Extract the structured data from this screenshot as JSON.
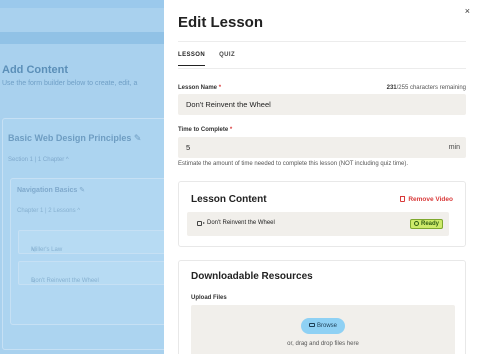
{
  "background": {
    "page_title": "Add Content",
    "page_subtitle": "Use the form builder below to create, edit, a",
    "course_title": "Basic Web Design Principles",
    "course_meta": "Section 1 | 1 Chapter ^",
    "chapter_title": "Navigation Basics",
    "chapter_meta": "Chapter 1 | 2 Lessons ^",
    "lessons": [
      "Miller's Law",
      "Don't Reinvent the Wheel"
    ]
  },
  "drawer": {
    "title": "Edit Lesson",
    "close_glyph": "×",
    "tabs": [
      {
        "label": "LESSON",
        "active": true
      },
      {
        "label": "QUIZ",
        "active": false
      }
    ],
    "lesson_name": {
      "label": "Lesson Name",
      "required_mark": "*",
      "value": "Don't Reinvent the Wheel",
      "counter_count": "231",
      "counter_suffix": "/255 characters remaining"
    },
    "time_to_complete": {
      "label": "Time to Complete",
      "required_mark": "*",
      "value": "5",
      "unit": "min",
      "help": "Estimate the amount of time needed to complete this lesson (NOT including quiz time)."
    },
    "lesson_content": {
      "title": "Lesson Content",
      "remove_label": "Remove Video",
      "video_name": "Don't Reinvent the Wheel",
      "status": "Ready"
    },
    "resources": {
      "title": "Downloadable Resources",
      "upload_label": "Upload Files",
      "browse_label": "Browse",
      "drag_text": "or, drag and drop files here"
    }
  },
  "colors": {
    "accent": "#8fd1f4",
    "danger": "#d93a3a",
    "ready": "#cdea6a",
    "overlay": "#a9d1ee"
  },
  "icons": [
    "close-icon",
    "edit-icon",
    "video-icon",
    "trash-icon",
    "check-icon",
    "folder-icon"
  ]
}
